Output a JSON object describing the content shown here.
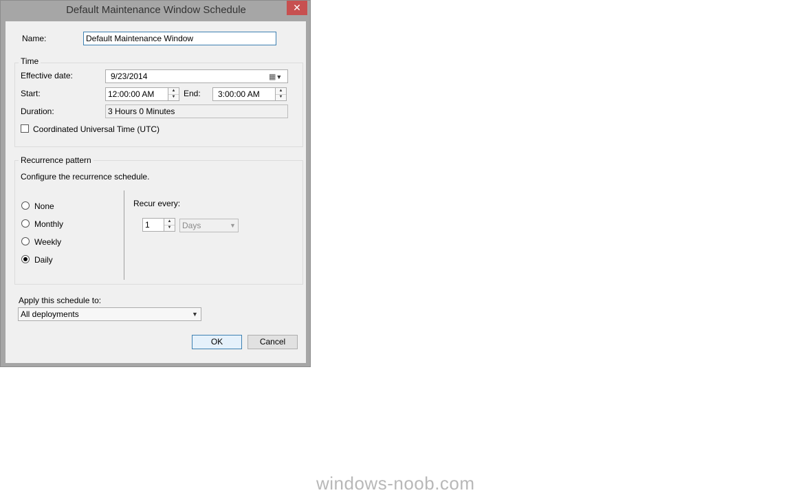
{
  "dialog": {
    "title": "Default Maintenance Window Schedule",
    "close_label": "✕",
    "name_label": "Name:",
    "name_value": "Default Maintenance Window"
  },
  "time": {
    "group_label": "Time",
    "effective_date_label": "Effective date:",
    "effective_date_value": "9/23/2014",
    "start_label": "Start:",
    "start_value": "12:00:00 AM",
    "end_label": "End:",
    "end_value": "3:00:00 AM",
    "duration_label": "Duration:",
    "duration_value": "3 Hours 0 Minutes",
    "utc_label": "Coordinated Universal Time (UTC)",
    "utc_checked": false
  },
  "recurrence": {
    "group_label": "Recurrence pattern",
    "description": "Configure the recurrence schedule.",
    "options": [
      {
        "label": "None",
        "selected": false
      },
      {
        "label": "Monthly",
        "selected": false
      },
      {
        "label": "Weekly",
        "selected": false
      },
      {
        "label": "Daily",
        "selected": true
      }
    ],
    "recur_every_label": "Recur every:",
    "recur_value": "1",
    "recur_unit": "Days"
  },
  "apply": {
    "label": "Apply this schedule to:",
    "value": "All deployments"
  },
  "buttons": {
    "ok": "OK",
    "cancel": "Cancel"
  },
  "watermark": "windows-noob.com",
  "colors": {
    "close_button": "#c75050",
    "default_button_border": "#3c7fb1",
    "dialog_background": "#f0f0f0"
  }
}
